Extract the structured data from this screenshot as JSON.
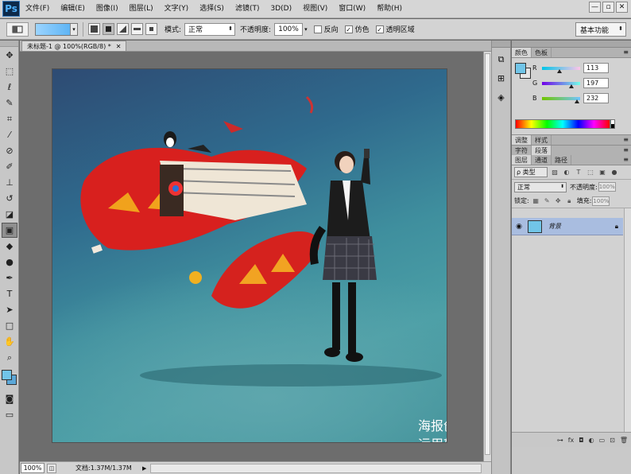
{
  "app": {
    "logo": "Ps"
  },
  "menu": [
    "文件(F)",
    "编辑(E)",
    "图像(I)",
    "图层(L)",
    "文字(Y)",
    "选择(S)",
    "滤镜(T)",
    "3D(D)",
    "视图(V)",
    "窗口(W)",
    "帮助(H)"
  ],
  "window_controls": {
    "minimize": "—",
    "restore": "▫",
    "close": "✕"
  },
  "options": {
    "mode_label": "模式:",
    "mode_value": "正常",
    "opacity_label": "不透明度:",
    "opacity_value": "100%",
    "reverse_label": "反向",
    "dither_label": "仿色",
    "transparency_label": "透明区域",
    "workspace": "基本功能",
    "gradient_colors": [
      "#9bd4ff",
      "#52aef2"
    ]
  },
  "document": {
    "tab_title": "未标题-1 @ 100%(RGB/8) *",
    "zoom": "100%",
    "doc_info": "文档:1.37M/1.37M",
    "caption_line1": "海报创意:图片合成处理",
    "caption_line2": "运用软件：photoshop"
  },
  "color_panel": {
    "tabs": [
      "颜色",
      "色板"
    ],
    "r_label": "R",
    "g_label": "G",
    "b_label": "B",
    "r": "113",
    "g": "197",
    "b": "232",
    "foreground": "#71c5e8"
  },
  "panel_strips": {
    "adjust_tabs": [
      "调整",
      "样式"
    ],
    "char_tabs": [
      "字符",
      "段落"
    ]
  },
  "layers_panel": {
    "tabs": [
      "图层",
      "通道",
      "路径"
    ],
    "filter_label": "ρ 类型",
    "blend_mode": "正常",
    "opacity_label": "不透明度:",
    "opacity_value": "100%",
    "lock_label": "锁定:",
    "fill_label": "填充:",
    "fill_value": "100%",
    "layers": [
      {
        "name": "背景",
        "visible": true,
        "locked": true
      }
    ]
  }
}
